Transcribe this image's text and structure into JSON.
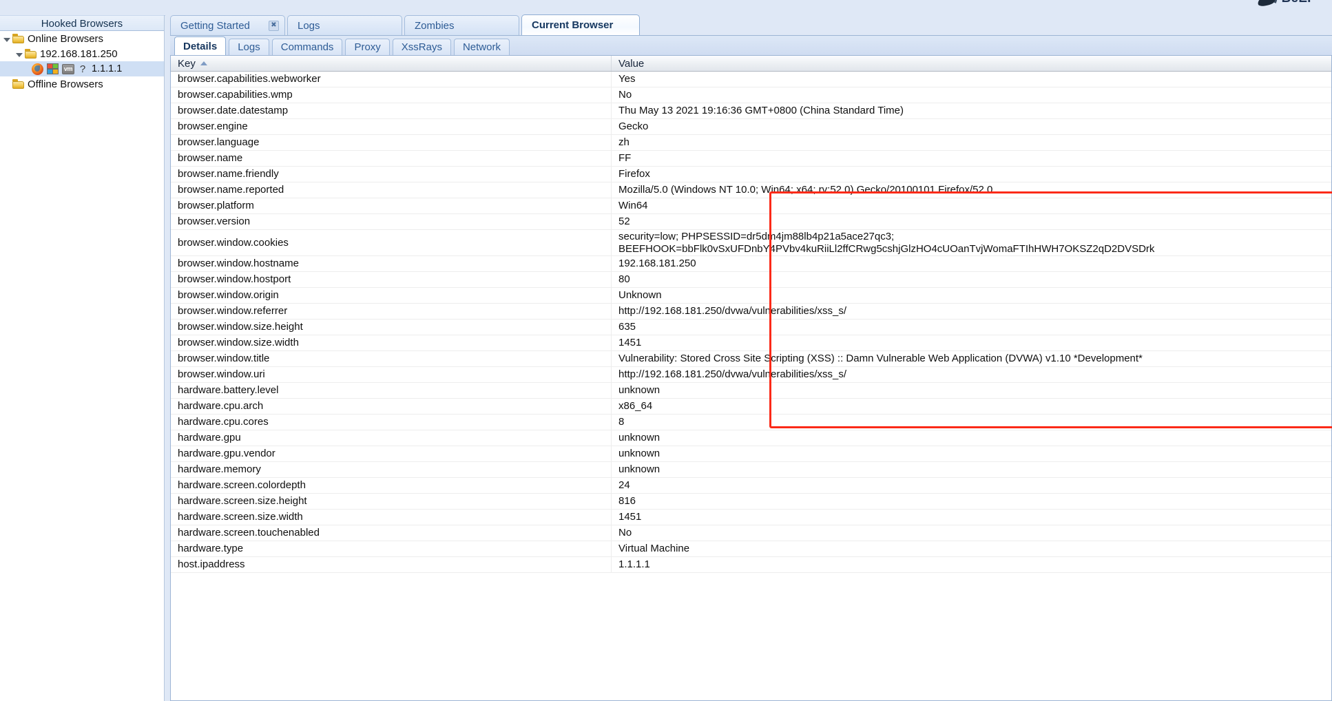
{
  "brand": {
    "name": "BeEF",
    "logo_icon": "beef-bull-logo-icon"
  },
  "sidebar": {
    "header": "Hooked Browsers",
    "nodes": [
      {
        "label": "Online Browsers",
        "icon": "folder-icon",
        "expander": "triangle-open-icon",
        "depth": 0,
        "selected": false
      },
      {
        "label": "192.168.181.250",
        "icon": "folder-icon",
        "expander": "triangle-open-icon",
        "depth": 1,
        "selected": false
      },
      {
        "label": "1.1.1.1",
        "icons": [
          "firefox-icon",
          "windows-icon",
          "vm-icon",
          "question-mark-icon"
        ],
        "depth": 2,
        "selected": true
      },
      {
        "label": "Offline Browsers",
        "icon": "folder-icon",
        "expander": "none",
        "depth": 0,
        "selected": false
      }
    ]
  },
  "outer_tabs": [
    {
      "label": "Getting Started",
      "active": false,
      "closable": true
    },
    {
      "label": "Logs",
      "active": false,
      "closable": false
    },
    {
      "label": "Zombies",
      "active": false,
      "closable": false
    },
    {
      "label": "Current Browser",
      "active": true,
      "closable": false
    }
  ],
  "inner_tabs": [
    {
      "label": "Details",
      "active": true
    },
    {
      "label": "Logs",
      "active": false
    },
    {
      "label": "Commands",
      "active": false
    },
    {
      "label": "Proxy",
      "active": false
    },
    {
      "label": "XssRays",
      "active": false
    },
    {
      "label": "Network",
      "active": false
    }
  ],
  "grid": {
    "columns": [
      {
        "label": "Key",
        "sort": "asc"
      },
      {
        "label": "Value",
        "sort": "none"
      }
    ],
    "rows": [
      {
        "key": "browser.capabilities.webworker",
        "value": "Yes"
      },
      {
        "key": "browser.capabilities.wmp",
        "value": "No"
      },
      {
        "key": "browser.date.datestamp",
        "value": "Thu May 13 2021 19:16:36 GMT+0800 (China Standard Time)"
      },
      {
        "key": "browser.engine",
        "value": "Gecko"
      },
      {
        "key": "browser.language",
        "value": "zh"
      },
      {
        "key": "browser.name",
        "value": "FF"
      },
      {
        "key": "browser.name.friendly",
        "value": "Firefox"
      },
      {
        "key": "browser.name.reported",
        "value": "Mozilla/5.0 (Windows NT 10.0; Win64; x64; rv:52.0) Gecko/20100101 Firefox/52.0"
      },
      {
        "key": "browser.platform",
        "value": "Win64"
      },
      {
        "key": "browser.version",
        "value": "52"
      },
      {
        "key": "browser.window.cookies",
        "value": "security=low; PHPSESSID=dr5dm4jm88lb4p21a5ace27qc3;\nBEEFHOOK=bbFlk0vSxUFDnbY4PVbv4kuRiiLl2ffCRwg5cshjGlzHO4cUOanTvjWomaFTIhHWH7OKSZ2qD2DVSDrk",
        "tall": true
      },
      {
        "key": "browser.window.hostname",
        "value": "192.168.181.250"
      },
      {
        "key": "browser.window.hostport",
        "value": "80"
      },
      {
        "key": "browser.window.origin",
        "value": "Unknown"
      },
      {
        "key": "browser.window.referrer",
        "value": "http://192.168.181.250/dvwa/vulnerabilities/xss_s/"
      },
      {
        "key": "browser.window.size.height",
        "value": "635"
      },
      {
        "key": "browser.window.size.width",
        "value": "1451"
      },
      {
        "key": "browser.window.title",
        "value": "Vulnerability: Stored Cross Site Scripting (XSS) :: Damn Vulnerable Web Application (DVWA) v1.10 *Development*"
      },
      {
        "key": "browser.window.uri",
        "value": "http://192.168.181.250/dvwa/vulnerabilities/xss_s/"
      },
      {
        "key": "hardware.battery.level",
        "value": "unknown"
      },
      {
        "key": "hardware.cpu.arch",
        "value": "x86_64"
      },
      {
        "key": "hardware.cpu.cores",
        "value": "8"
      },
      {
        "key": "hardware.gpu",
        "value": "unknown"
      },
      {
        "key": "hardware.gpu.vendor",
        "value": "unknown"
      },
      {
        "key": "hardware.memory",
        "value": "unknown"
      },
      {
        "key": "hardware.screen.colordepth",
        "value": "24"
      },
      {
        "key": "hardware.screen.size.height",
        "value": "816"
      },
      {
        "key": "hardware.screen.size.width",
        "value": "1451"
      },
      {
        "key": "hardware.screen.touchenabled",
        "value": "No"
      },
      {
        "key": "hardware.type",
        "value": "Virtual Machine"
      },
      {
        "key": "host.ipaddress",
        "value": "1.1.1.1"
      }
    ]
  },
  "annotation": {
    "type": "highlight-rectangle",
    "color": "#fb2a18"
  }
}
